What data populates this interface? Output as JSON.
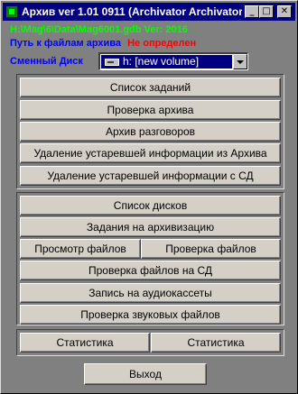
{
  "window": {
    "title": "Архив ver 1.01 0911 (Archivator Archivator)"
  },
  "title_buttons": {
    "minimize": "_",
    "maximize": "□",
    "close": "✕"
  },
  "db_path": "H:\\Mag\\6\\Data\\Mag6001.gdb  Ver: 2016",
  "archive_path": {
    "label": "Путь к файлам архива",
    "value": "Не определен"
  },
  "removable_disk": {
    "label": "Сменный Диск",
    "selected": "h: [new volume]"
  },
  "group1": [
    "Список заданий",
    "Проверка архива",
    "Архив разговоров",
    "Удаление устаревшей информации из Архива",
    "Удаление устаревшей информации с СД"
  ],
  "group2": {
    "disk_list": "Список дисков",
    "archive_tasks": "Задания на архивизацию",
    "view_files": "Просмотр файлов",
    "check_files": "Проверка файлов",
    "check_files_cd": "Проверка файлов на СД",
    "record_tape": "Запись на аудиокассеты",
    "check_sound": "Проверка звуковых файлов"
  },
  "stats": [
    "Статистика",
    "Статистика"
  ],
  "exit": "Выход",
  "colors": {
    "title_bar": "#000080",
    "path_green": "#00ff00",
    "label_blue": "#0000ff",
    "value_red": "#ff0000",
    "background": "#808080"
  }
}
